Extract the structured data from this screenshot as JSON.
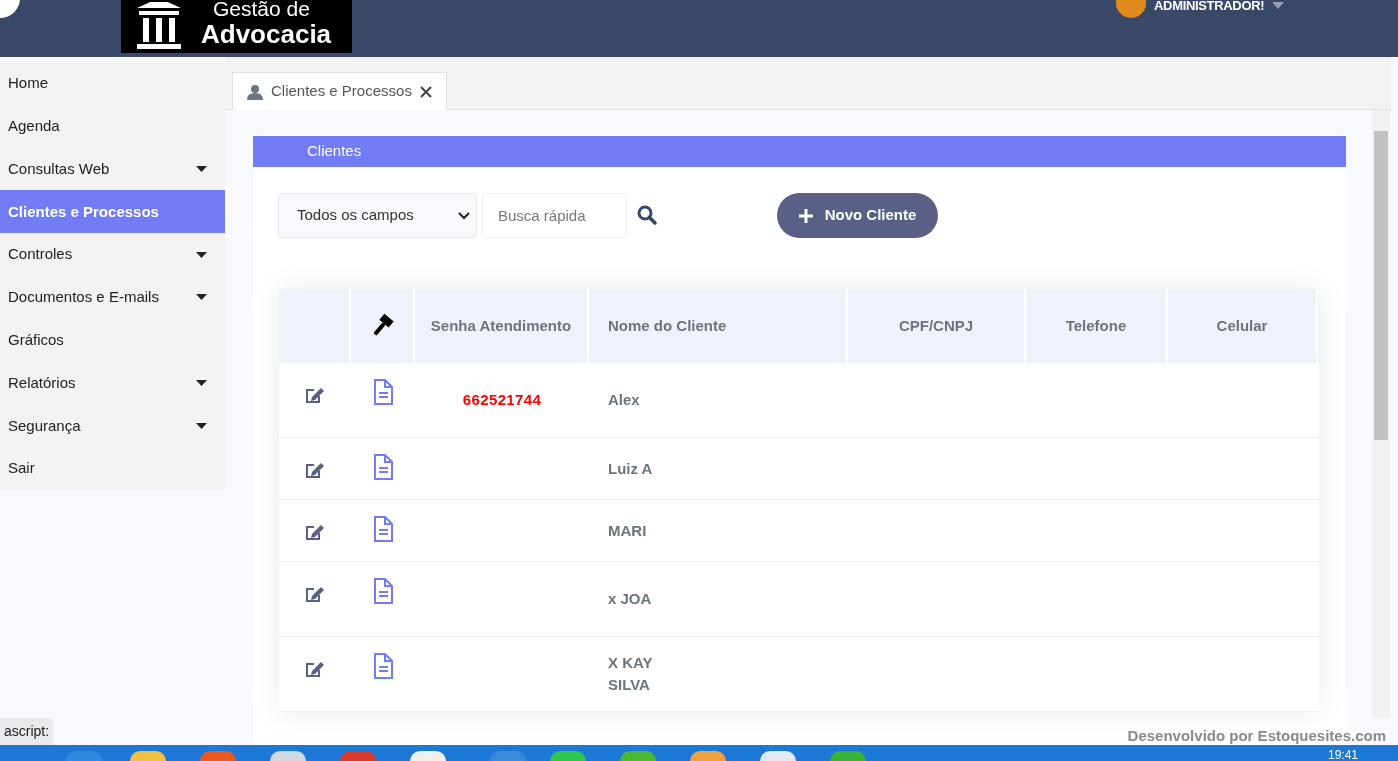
{
  "header": {
    "logo_line1": "Gestão de",
    "logo_line2": "Advocacia",
    "user_name": "ADMINISTRADOR!"
  },
  "sidebar": {
    "items": [
      {
        "label": "Home",
        "expandable": false,
        "selected": false
      },
      {
        "label": "Agenda",
        "expandable": false,
        "selected": false
      },
      {
        "label": "Consultas Web",
        "expandable": true,
        "selected": false
      },
      {
        "label": "Clientes e Processos",
        "expandable": false,
        "selected": true
      },
      {
        "label": "Controles",
        "expandable": true,
        "selected": false
      },
      {
        "label": "Documentos e E-mails",
        "expandable": true,
        "selected": false
      },
      {
        "label": "Gráficos",
        "expandable": false,
        "selected": false
      },
      {
        "label": "Relatórios",
        "expandable": true,
        "selected": false
      },
      {
        "label": "Segurança",
        "expandable": true,
        "selected": false
      },
      {
        "label": "Sair",
        "expandable": false,
        "selected": false
      }
    ]
  },
  "tabs": [
    {
      "label": "Clientes e Processos",
      "selected": true
    }
  ],
  "panel": {
    "title": "Clientes",
    "field_select": "Todos os campos",
    "search_placeholder": "Busca rápida",
    "new_button": "Novo Cliente"
  },
  "table": {
    "columns": [
      {
        "kind": "blank"
      },
      {
        "kind": "gavel"
      },
      {
        "kind": "text",
        "label": "Senha Atendimento"
      },
      {
        "kind": "text",
        "label": "Nome do Cliente"
      },
      {
        "kind": "text",
        "label": "CPF/CNPJ"
      },
      {
        "kind": "text",
        "label": "Telefone"
      },
      {
        "kind": "text",
        "label": "Celular"
      }
    ],
    "rows": [
      {
        "senha": "662521744",
        "name": "Alex"
      },
      {
        "name": "Luiz A"
      },
      {
        "name": "MARI"
      },
      {
        "name": "x JOA"
      },
      {
        "name": "X KAY\nSILVA"
      }
    ]
  },
  "status_text": "ascript:",
  "footer": "Desenvolvido por Estoquesites.com",
  "clock": "19:41"
}
